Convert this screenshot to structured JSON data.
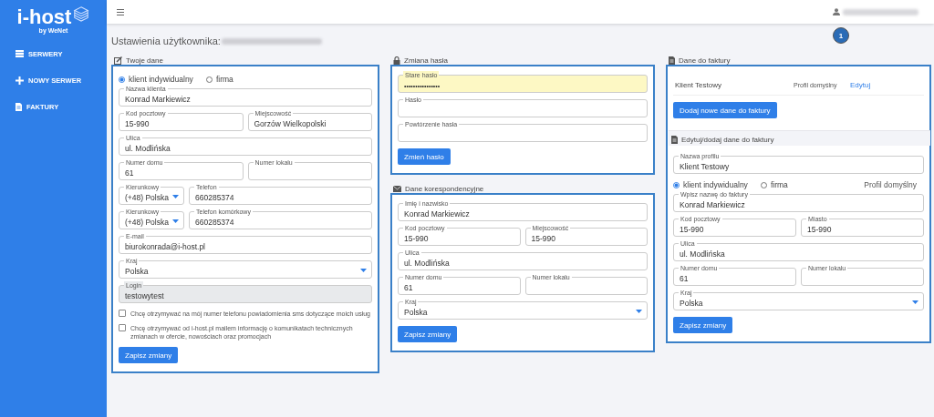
{
  "brand": {
    "name": "i-host",
    "tagline": "by WeNet"
  },
  "sidebar": {
    "items": [
      {
        "label": "SERWERY"
      },
      {
        "label": "NOWY SERWER"
      },
      {
        "label": "FAKTURY"
      }
    ]
  },
  "callout": {
    "label": "1"
  },
  "page_title": "Ustawienia użytkownika:",
  "columns": [
    {
      "panels": [
        {
          "title": "Twoje dane",
          "items": [
            {
              "kind": "radio",
              "options": [
                {
                  "label": "klient indywidualny",
                  "selected": true
                },
                {
                  "label": "firma",
                  "selected": false
                }
              ]
            },
            {
              "kind": "fields",
              "fields": [
                {
                  "label": "Nazwa klienta",
                  "value": "Konrad Markiewicz",
                  "kind": "text"
                }
              ]
            },
            {
              "kind": "fields",
              "fields": [
                {
                  "label": "Kod pocztowy",
                  "value": "15-990",
                  "kind": "text"
                },
                {
                  "label": "Miejscowość",
                  "value": "Gorzów Wielkopolski",
                  "kind": "text"
                }
              ]
            },
            {
              "kind": "fields",
              "fields": [
                {
                  "label": "Ulica",
                  "value": "ul. Modlińska",
                  "kind": "text"
                }
              ]
            },
            {
              "kind": "fields",
              "fields": [
                {
                  "label": "Numer domu",
                  "value": "61",
                  "kind": "text"
                },
                {
                  "label": "Numer lokalu",
                  "kind": "text"
                }
              ]
            },
            {
              "kind": "fields",
              "fields": [
                {
                  "label": "Kierunkowy",
                  "value": "(+48) Polska",
                  "kind": "select"
                },
                {
                  "label": "Telefon",
                  "value": "660285374",
                  "kind": "text"
                }
              ]
            },
            {
              "kind": "fields",
              "fields": [
                {
                  "label": "Kierunkowy",
                  "value": "(+48) Polska",
                  "kind": "select"
                },
                {
                  "label": "Telefon komórkowy",
                  "value": "660285374",
                  "kind": "text"
                }
              ]
            },
            {
              "kind": "fields",
              "fields": [
                {
                  "label": "E-mail",
                  "value": "biurokonrada@i-host.pl",
                  "kind": "text"
                }
              ]
            },
            {
              "kind": "fields",
              "fields": [
                {
                  "label": "Kraj",
                  "value": "Polska",
                  "kind": "select"
                }
              ]
            },
            {
              "kind": "fields",
              "fields": [
                {
                  "label": "Login",
                  "value": "testowytest",
                  "kind": "disabled"
                }
              ]
            },
            {
              "kind": "checkbox",
              "label": "Chcę otrzymywać na mój numer telefonu powiadomienia sms dotyczące moich usług",
              "checked": false
            },
            {
              "kind": "checkbox",
              "label": "Chcę otrzymywać od i-host.pl mailem informację o komunikatach technicznych zmianach w ofercie, nowościach oraz promocjach",
              "checked": false
            },
            {
              "kind": "button",
              "label": "Zapisz zmiany"
            }
          ]
        }
      ]
    },
    {
      "panels": [
        {
          "title": "Zmiana hasła",
          "items": [
            {
              "kind": "fields",
              "fields": [
                {
                  "label": "Stare hasło",
                  "value": "••••••••••••••••",
                  "kind": "autofilled"
                }
              ]
            },
            {
              "kind": "fields",
              "fields": [
                {
                  "label": "Hasło",
                  "kind": "text"
                }
              ]
            },
            {
              "kind": "fields",
              "fields": [
                {
                  "label": "Powtórzenie hasła",
                  "kind": "text"
                }
              ]
            },
            {
              "kind": "button",
              "label": "Zmień hasło"
            }
          ]
        },
        {
          "title": "Dane korespondencyjne",
          "items": [
            {
              "kind": "fields",
              "fields": [
                {
                  "label": "Imię i nazwisko",
                  "value": "Konrad Markiewicz",
                  "kind": "text"
                }
              ]
            },
            {
              "kind": "fields",
              "fields": [
                {
                  "label": "Kod pocztowy",
                  "value": "15-990",
                  "kind": "text"
                },
                {
                  "label": "Miejscowość",
                  "value": "15-990",
                  "kind": "text"
                }
              ]
            },
            {
              "kind": "fields",
              "fields": [
                {
                  "label": "Ulica",
                  "value": "ul. Modlińska",
                  "kind": "text"
                }
              ]
            },
            {
              "kind": "fields",
              "fields": [
                {
                  "label": "Numer domu",
                  "value": "61",
                  "kind": "text"
                },
                {
                  "label": "Numer lokalu",
                  "kind": "text"
                }
              ]
            },
            {
              "kind": "fields",
              "fields": [
                {
                  "label": "Kraj",
                  "value": "Polska",
                  "kind": "select"
                }
              ]
            },
            {
              "kind": "button",
              "label": "Zapisz zmiany"
            }
          ]
        }
      ]
    },
    {
      "panels": [
        {
          "title": "Dane do faktury",
          "items": [
            {
              "kind": "profile",
              "name": "Klient Testowy",
              "tag": "Profil domyślny",
              "link": "Edytuj"
            },
            {
              "kind": "button",
              "label": "Dodaj nowe dane do faktury"
            },
            {
              "kind": "subheading",
              "title": "Edytuj/dodaj dane do faktury"
            },
            {
              "kind": "fields",
              "fields": [
                {
                  "label": "Nazwa profilu",
                  "value": "Klient Testowy",
                  "kind": "text"
                }
              ]
            },
            {
              "kind": "radio",
              "options": [
                {
                  "label": "klient indywidualny",
                  "selected": true
                },
                {
                  "label": "firma",
                  "selected": false
                }
              ],
              "note": "Profil domyślny"
            },
            {
              "kind": "fields",
              "fields": [
                {
                  "label": "Wpisz nazwę do faktury",
                  "value": "Konrad Markiewicz",
                  "kind": "text"
                }
              ]
            },
            {
              "kind": "fields",
              "fields": [
                {
                  "label": "Kod pocztowy",
                  "value": "15-990",
                  "kind": "text"
                },
                {
                  "label": "Miasto",
                  "value": "15-990",
                  "kind": "text"
                }
              ]
            },
            {
              "kind": "fields",
              "fields": [
                {
                  "label": "Ulica",
                  "value": "ul. Modlińska",
                  "kind": "text"
                }
              ]
            },
            {
              "kind": "fields",
              "fields": [
                {
                  "label": "Numer domu",
                  "value": "61",
                  "kind": "text"
                },
                {
                  "label": "Numer lokalu",
                  "kind": "text"
                }
              ]
            },
            {
              "kind": "fields",
              "fields": [
                {
                  "label": "Kraj",
                  "value": "Polska",
                  "kind": "select"
                }
              ]
            },
            {
              "kind": "button",
              "label": "Zapisz zmiany"
            }
          ]
        }
      ]
    }
  ]
}
